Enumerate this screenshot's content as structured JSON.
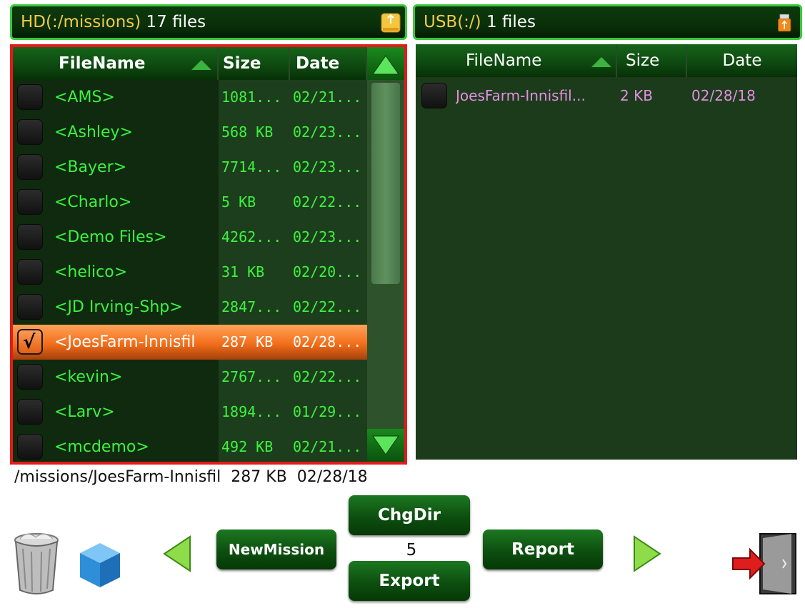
{
  "hd_panel": {
    "path_label": "HD(:/missions)",
    "count_label": "17 files",
    "icon": "hard-drive-icon"
  },
  "usb_panel": {
    "path_label": "USB(:/)",
    "count_label": "1 files",
    "icon": "usb-drive-icon"
  },
  "left_list": {
    "columns": [
      "FileName",
      "Size",
      "Date"
    ],
    "rows": [
      {
        "name": "<AMS>",
        "size": "1081...",
        "date": "02/21...",
        "checked": false
      },
      {
        "name": "<Ashley>",
        "size": "568 KB",
        "date": "02/23...",
        "checked": false
      },
      {
        "name": "<Bayer>",
        "size": "7714...",
        "date": "02/23...",
        "checked": false
      },
      {
        "name": "<Charlo>",
        "size": "5 KB",
        "date": "02/22...",
        "checked": false
      },
      {
        "name": "<Demo Files>",
        "size": "4262...",
        "date": "02/23...",
        "checked": false
      },
      {
        "name": "<helico>",
        "size": "31 KB",
        "date": "02/20...",
        "checked": false
      },
      {
        "name": "<JD Irving-Shp>",
        "size": "2847...",
        "date": "02/22...",
        "checked": false
      },
      {
        "name": "<JoesFarm-Innisfil",
        "size": "287 KB",
        "date": "02/28...",
        "checked": true
      },
      {
        "name": "<kevin>",
        "size": "2767...",
        "date": "02/22...",
        "checked": false
      },
      {
        "name": "<Larv>",
        "size": "1894...",
        "date": "01/29...",
        "checked": false
      },
      {
        "name": "<mcdemo>",
        "size": "492 KB",
        "date": "02/21...",
        "checked": false
      }
    ]
  },
  "right_list": {
    "columns": [
      "FileName",
      "Size",
      "Date"
    ],
    "rows": [
      {
        "name": "JoesFarm-Innisfil...",
        "size": "2 KB",
        "date": "02/28/18"
      }
    ]
  },
  "status": {
    "path": "/missions/JoesFarm-Innisfil",
    "size": "287 KB",
    "date": "02/28/18"
  },
  "toolbar": {
    "new_mission": "NewMission",
    "chg_dir": "ChgDir",
    "export": "Export",
    "report": "Report",
    "page_number": "5",
    "icons": [
      "trash-can-icon",
      "cube-icon",
      "prev-arrow-icon",
      "next-arrow-icon",
      "exit-door-icon"
    ]
  },
  "colors": {
    "accent_green": "#3cf23f",
    "selected_orange": "#f36e1a",
    "frame_red": "#e21b1b",
    "usb_text": "#e38ee3",
    "hd_path": "#f2c84b"
  }
}
